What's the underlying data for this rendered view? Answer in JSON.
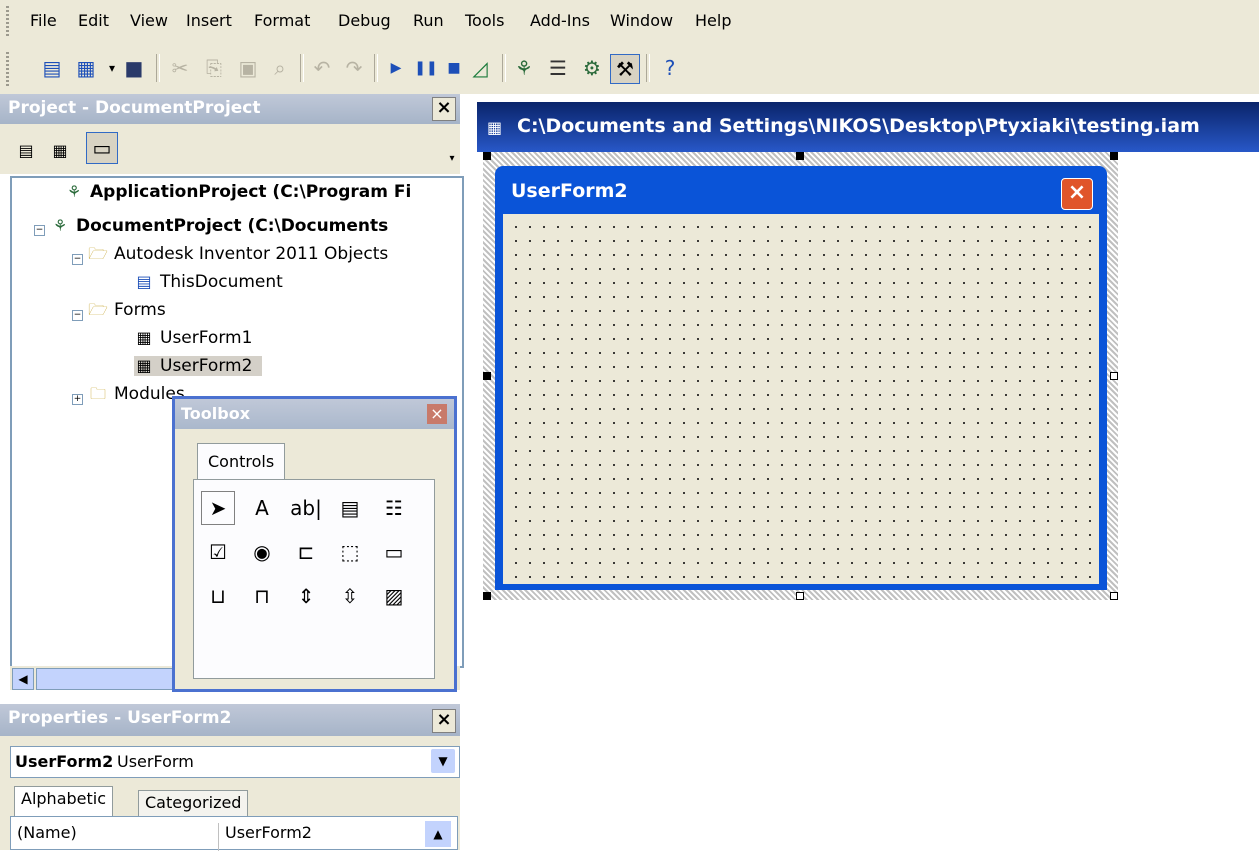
{
  "menu": {
    "items": [
      "File",
      "Edit",
      "View",
      "Insert",
      "Format",
      "Debug",
      "Run",
      "Tools",
      "Add-Ins",
      "Window",
      "Help"
    ],
    "mnemonics": [
      "F",
      "E",
      "V",
      "I",
      "o",
      "D",
      "R",
      "T",
      "A",
      "W",
      "H"
    ]
  },
  "toolbar": {
    "icons": [
      "view-object-icon",
      "insert-userform-icon",
      "dropdown-icon",
      "save-icon",
      "cut-icon",
      "copy-icon",
      "paste-icon",
      "find-icon",
      "undo-icon",
      "redo-icon",
      "run-icon",
      "break-icon",
      "reset-icon",
      "design-mode-icon",
      "project-explorer-icon",
      "properties-window-icon",
      "object-browser-icon",
      "toolbox-icon",
      "help-icon"
    ]
  },
  "project": {
    "title": "Project - DocumentProject",
    "close": "×",
    "tree": [
      {
        "label": "ApplicationProject (C:\\Program Fi",
        "bold": true
      },
      {
        "label": "DocumentProject (C:\\Documents",
        "bold": true
      },
      {
        "label": "Autodesk Inventor 2011 Objects"
      },
      {
        "label": "ThisDocument"
      },
      {
        "label": "Forms"
      },
      {
        "label": "UserForm1"
      },
      {
        "label": "UserForm2"
      },
      {
        "label": "Modules"
      }
    ]
  },
  "toolbox": {
    "title": "Toolbox",
    "close": "×",
    "tab": "Controls",
    "tools": [
      {
        "name": "pointer-tool",
        "glyph": "➤"
      },
      {
        "name": "label-tool",
        "glyph": "A"
      },
      {
        "name": "textbox-tool",
        "glyph": "ab|"
      },
      {
        "name": "combobox-tool",
        "glyph": "▤"
      },
      {
        "name": "listbox-tool",
        "glyph": "☷"
      },
      {
        "name": "checkbox-tool",
        "glyph": "☑"
      },
      {
        "name": "optionbutton-tool",
        "glyph": "◉"
      },
      {
        "name": "togglebutton-tool",
        "glyph": "⊏"
      },
      {
        "name": "frame-tool",
        "glyph": "⬚"
      },
      {
        "name": "commandbutton-tool",
        "glyph": "▭"
      },
      {
        "name": "tabstrip-tool",
        "glyph": "⊔"
      },
      {
        "name": "multipage-tool",
        "glyph": "⊓"
      },
      {
        "name": "scrollbar-tool",
        "glyph": "⇕"
      },
      {
        "name": "spinbutton-tool",
        "glyph": "⇳"
      },
      {
        "name": "image-tool",
        "glyph": "▨"
      }
    ]
  },
  "properties": {
    "title": "Properties - UserForm2",
    "close": "×",
    "object_name": "UserForm2",
    "object_type": "UserForm",
    "tabs": [
      "Alphabetic",
      "Categorized"
    ],
    "rows": [
      {
        "name": "(Name)",
        "value": "UserForm2"
      }
    ]
  },
  "designer": {
    "title": "C:\\Documents and Settings\\NIKOS\\Desktop\\Ptyxiaki\\testing.iam",
    "form_title": "UserForm2",
    "form_close": "×"
  },
  "colors": {
    "xp_blue": "#0a54d8",
    "face": "#ece9d8",
    "panel_title": "#a6b4c8"
  }
}
